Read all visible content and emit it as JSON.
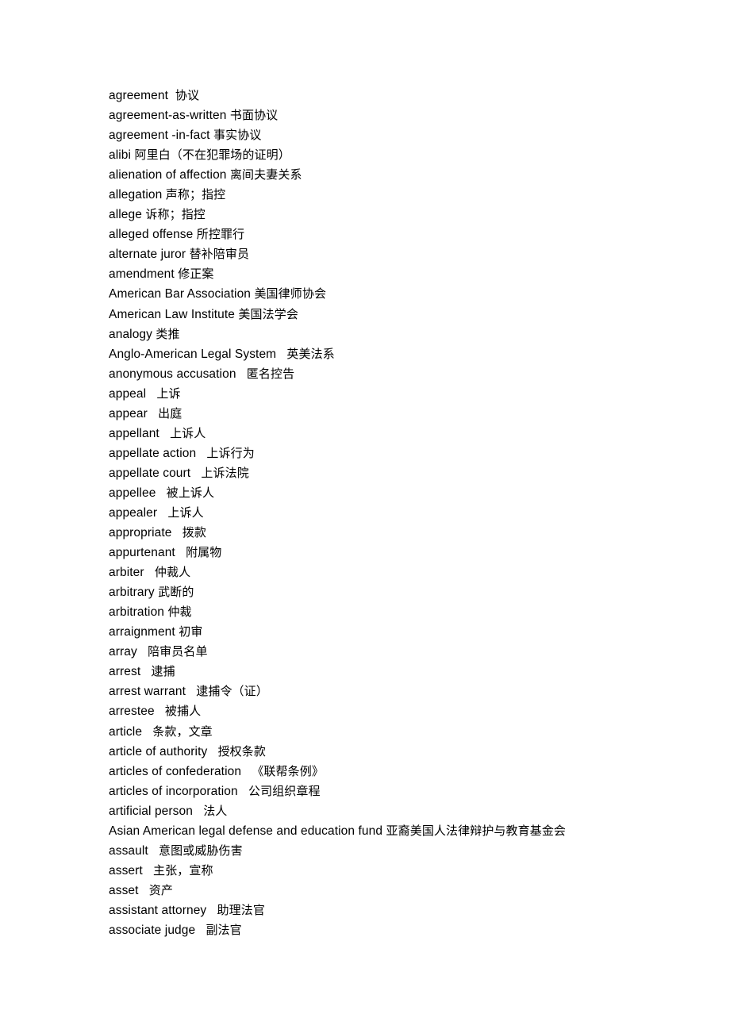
{
  "document": {
    "type": "bilingual-glossary",
    "language_pair": "English-Chinese",
    "page_background": "#ffffff",
    "text_color": "#000000",
    "entries": [
      {
        "term": "agreement",
        "gap": "  ",
        "gloss": "协议"
      },
      {
        "term": "agreement-as-written",
        "gap": " ",
        "gloss": "书面协议"
      },
      {
        "term": "agreement -in-fact",
        "gap": " ",
        "gloss": "事实协议"
      },
      {
        "term": "alibi",
        "gap": " ",
        "gloss": "阿里白（不在犯罪场的证明）"
      },
      {
        "term": "alienation of affection",
        "gap": " ",
        "gloss": "离间夫妻关系"
      },
      {
        "term": "allegation",
        "gap": " ",
        "gloss": "声称；指控"
      },
      {
        "term": "allege",
        "gap": " ",
        "gloss": "诉称；指控"
      },
      {
        "term": "alleged offense",
        "gap": " ",
        "gloss": "所控罪行"
      },
      {
        "term": "alternate juror",
        "gap": " ",
        "gloss": "替补陪审员"
      },
      {
        "term": "amendment",
        "gap": " ",
        "gloss": "修正案"
      },
      {
        "term": "American Bar Association",
        "gap": " ",
        "gloss": "美国律师协会"
      },
      {
        "term": "American Law Institute",
        "gap": " ",
        "gloss": "美国法学会"
      },
      {
        "term": "analogy",
        "gap": " ",
        "gloss": "类推"
      },
      {
        "term": "Anglo-American Legal System",
        "gap": "   ",
        "gloss": "英美法系"
      },
      {
        "term": "anonymous accusation",
        "gap": "   ",
        "gloss": "匿名控告"
      },
      {
        "term": "appeal",
        "gap": "   ",
        "gloss": "上诉"
      },
      {
        "term": "appear",
        "gap": "   ",
        "gloss": "出庭"
      },
      {
        "term": "appellant",
        "gap": "   ",
        "gloss": "上诉人"
      },
      {
        "term": "appellate action",
        "gap": "   ",
        "gloss": "上诉行为"
      },
      {
        "term": "appellate court",
        "gap": "   ",
        "gloss": "上诉法院"
      },
      {
        "term": "appellee",
        "gap": "   ",
        "gloss": "被上诉人"
      },
      {
        "term": "appealer",
        "gap": "   ",
        "gloss": "上诉人"
      },
      {
        "term": "appropriate",
        "gap": "   ",
        "gloss": "拨款"
      },
      {
        "term": "appurtenant",
        "gap": "   ",
        "gloss": "附属物"
      },
      {
        "term": "arbiter",
        "gap": "   ",
        "gloss": "仲裁人"
      },
      {
        "term": "arbitrary",
        "gap": " ",
        "gloss": "武断的"
      },
      {
        "term": "arbitration",
        "gap": " ",
        "gloss": "仲裁"
      },
      {
        "term": "arraignment",
        "gap": " ",
        "gloss": "初审"
      },
      {
        "term": "array",
        "gap": "   ",
        "gloss": "陪审员名单"
      },
      {
        "term": "arrest",
        "gap": "   ",
        "gloss": "逮捕"
      },
      {
        "term": "arrest warrant",
        "gap": "   ",
        "gloss": "逮捕令（证）"
      },
      {
        "term": "arrestee",
        "gap": "   ",
        "gloss": "被捕人"
      },
      {
        "term": "article",
        "gap": "   ",
        "gloss": "条款，文章"
      },
      {
        "term": "article of authority",
        "gap": "   ",
        "gloss": "授权条款"
      },
      {
        "term": "articles of confederation",
        "gap": "   ",
        "gloss": "《联帮条例》"
      },
      {
        "term": "articles of incorporation",
        "gap": "   ",
        "gloss": "公司组织章程"
      },
      {
        "term": "artificial person",
        "gap": "   ",
        "gloss": "法人"
      },
      {
        "term": "Asian American legal defense and education fund",
        "gap": " ",
        "gloss": "亚裔美国人法律辩护与教育基金会"
      },
      {
        "term": "assault",
        "gap": "   ",
        "gloss": "意图或威胁伤害"
      },
      {
        "term": "assert",
        "gap": "   ",
        "gloss": "主张，宣称"
      },
      {
        "term": "asset",
        "gap": "   ",
        "gloss": "资产"
      },
      {
        "term": "assistant attorney",
        "gap": "   ",
        "gloss": "助理法官"
      },
      {
        "term": "associate judge",
        "gap": "   ",
        "gloss": "副法官"
      }
    ]
  }
}
